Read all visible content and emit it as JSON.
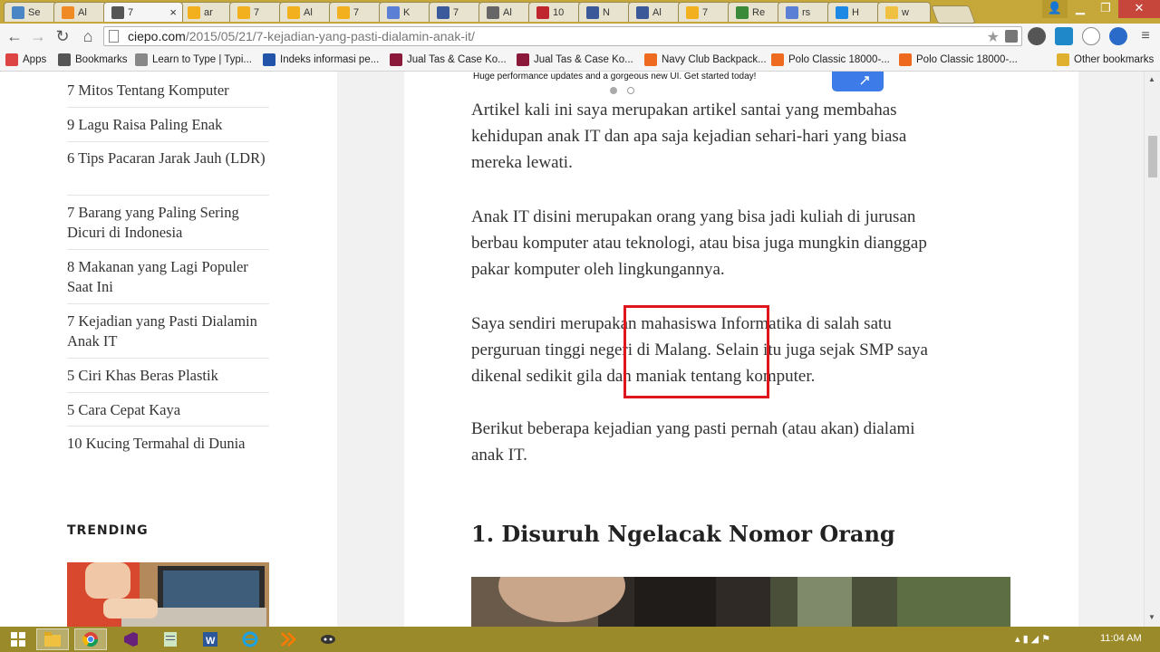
{
  "browser": {
    "tabs": [
      {
        "label": "Se",
        "favicon_color": "#4a86c5",
        "favicon_glyph": "doc-icon"
      },
      {
        "label": "Al",
        "favicon_color": "#f08a24",
        "favicon_glyph": "chart-icon"
      },
      {
        "label": "7",
        "favicon_color": "#555555",
        "favicon_glyph": "bird-icon",
        "active": true
      },
      {
        "label": "ar",
        "favicon_color": "#f2b01e",
        "favicon_glyph": "k"
      },
      {
        "label": "7",
        "favicon_color": "#f2b01e",
        "favicon_glyph": "k"
      },
      {
        "label": "Al",
        "favicon_color": "#f2b01e",
        "favicon_glyph": "k"
      },
      {
        "label": "7",
        "favicon_color": "#f2b01e",
        "favicon_glyph": "k"
      },
      {
        "label": "K",
        "favicon_color": "#5a7fd4",
        "favicon_glyph": "8"
      },
      {
        "label": "7",
        "favicon_color": "#3a5a9b",
        "favicon_glyph": "o"
      },
      {
        "label": "Al",
        "favicon_color": "#666666",
        "favicon_glyph": "person"
      },
      {
        "label": "10",
        "favicon_color": "#c0262d",
        "favicon_glyph": "m"
      },
      {
        "label": "N",
        "favicon_color": "#3b5998",
        "favicon_glyph": "f"
      },
      {
        "label": "Al",
        "favicon_color": "#3b5998",
        "favicon_glyph": "f"
      },
      {
        "label": "7",
        "favicon_color": "#f2b01e",
        "favicon_glyph": "k"
      },
      {
        "label": "Re",
        "favicon_color": "#3a8a3a",
        "favicon_glyph": "globe"
      },
      {
        "label": "rs",
        "favicon_color": "#5a7fd4",
        "favicon_glyph": "8"
      },
      {
        "label": "H",
        "favicon_color": "#1e88e5",
        "favicon_glyph": "win"
      },
      {
        "label": "w",
        "favicon_color": "#f0c040",
        "favicon_glyph": "w"
      }
    ],
    "close_tab_symbol": "×",
    "url_domain": "ciepo.com",
    "url_path": "/2015/05/21/7-kejadian-yang-pasti-dialamin-anak-it/",
    "bookmarks": [
      {
        "label": "Apps",
        "icon": "apps-grid-icon",
        "color": "#d44"
      },
      {
        "label": "Bookmarks",
        "icon": "star-icon",
        "color": "#555"
      },
      {
        "label": "Learn to Type | Typi...",
        "icon": "typing-icon",
        "color": "#888"
      },
      {
        "label": "Indeks informasi pe...",
        "icon": "indeks-icon",
        "color": "#2255aa"
      },
      {
        "label": "Jual Tas & Case Ko...",
        "icon": "bl-icon",
        "color": "#8b1a3a"
      },
      {
        "label": "Jual Tas & Case Ko...",
        "icon": "bl-icon",
        "color": "#8b1a3a"
      },
      {
        "label": "Navy Club Backpack...",
        "icon": "shop-icon",
        "color": "#ee6a1f"
      },
      {
        "label": "Polo Classic 18000-...",
        "icon": "shop-icon",
        "color": "#ee6a1f"
      },
      {
        "label": "Polo Classic 18000-...",
        "icon": "shop-icon",
        "color": "#ee6a1f"
      }
    ],
    "other_bookmarks": "Other bookmarks"
  },
  "sidebar": {
    "links": [
      "7 Mitos Tentang Komputer",
      "9 Lagu Raisa Paling Enak",
      "6 Tips Pacaran Jarak Jauh (LDR)",
      "7 Barang yang Paling Sering Dicuri di Indonesia",
      "8 Makanan yang Lagi Populer Saat Ini",
      "7 Kejadian yang Pasti Dialamin Anak IT",
      "5 Ciri Khas Beras Plastik",
      "5 Cara Cepat Kaya",
      "10 Kucing Termahal di Dunia"
    ],
    "trending_title": "TRENDING"
  },
  "article": {
    "promo_text": "Huge performance updates and a gorgeous new UI. Get started today!",
    "paragraphs": [
      [
        "Artikel kali ini saya merupakan artikel santai yang membahas",
        "kehidupan anak IT dan apa saja kejadian sehari-hari yang biasa",
        "mereka lewati."
      ],
      [
        "Anak IT disini merupakan orang yang bisa jadi kuliah di jurusan",
        "berbau komputer atau teknologi, atau bisa juga mungkin dianggap",
        "pakar komputer oleh lingkungannya."
      ],
      [
        "Saya sendiri merupakan mahasiswa Informatika di salah satu",
        "perguruan tinggi negeri di Malang. Selain itu juga sejak SMP saya",
        "dikenal sedikit gila dan maniak tentang komputer."
      ],
      [
        "Berikut beberapa kejadian yang pasti pernah (atau akan) dialami",
        "anak IT."
      ]
    ],
    "heading": "1. Disuruh Ngelacak Nomor Orang"
  },
  "taskbar": {
    "clock": "11:04 AM",
    "apps": [
      "start-icon",
      "file-explorer-icon",
      "chrome-icon",
      "visual-studio-icon",
      "notepad-icon",
      "word-icon",
      "internet-explorer-icon",
      "app-icon",
      "game-icon"
    ]
  },
  "colors": {
    "accent_red_box": "#e0161e",
    "promo_blue": "#3d7be8",
    "chrome_frame": "#c5a73a"
  }
}
